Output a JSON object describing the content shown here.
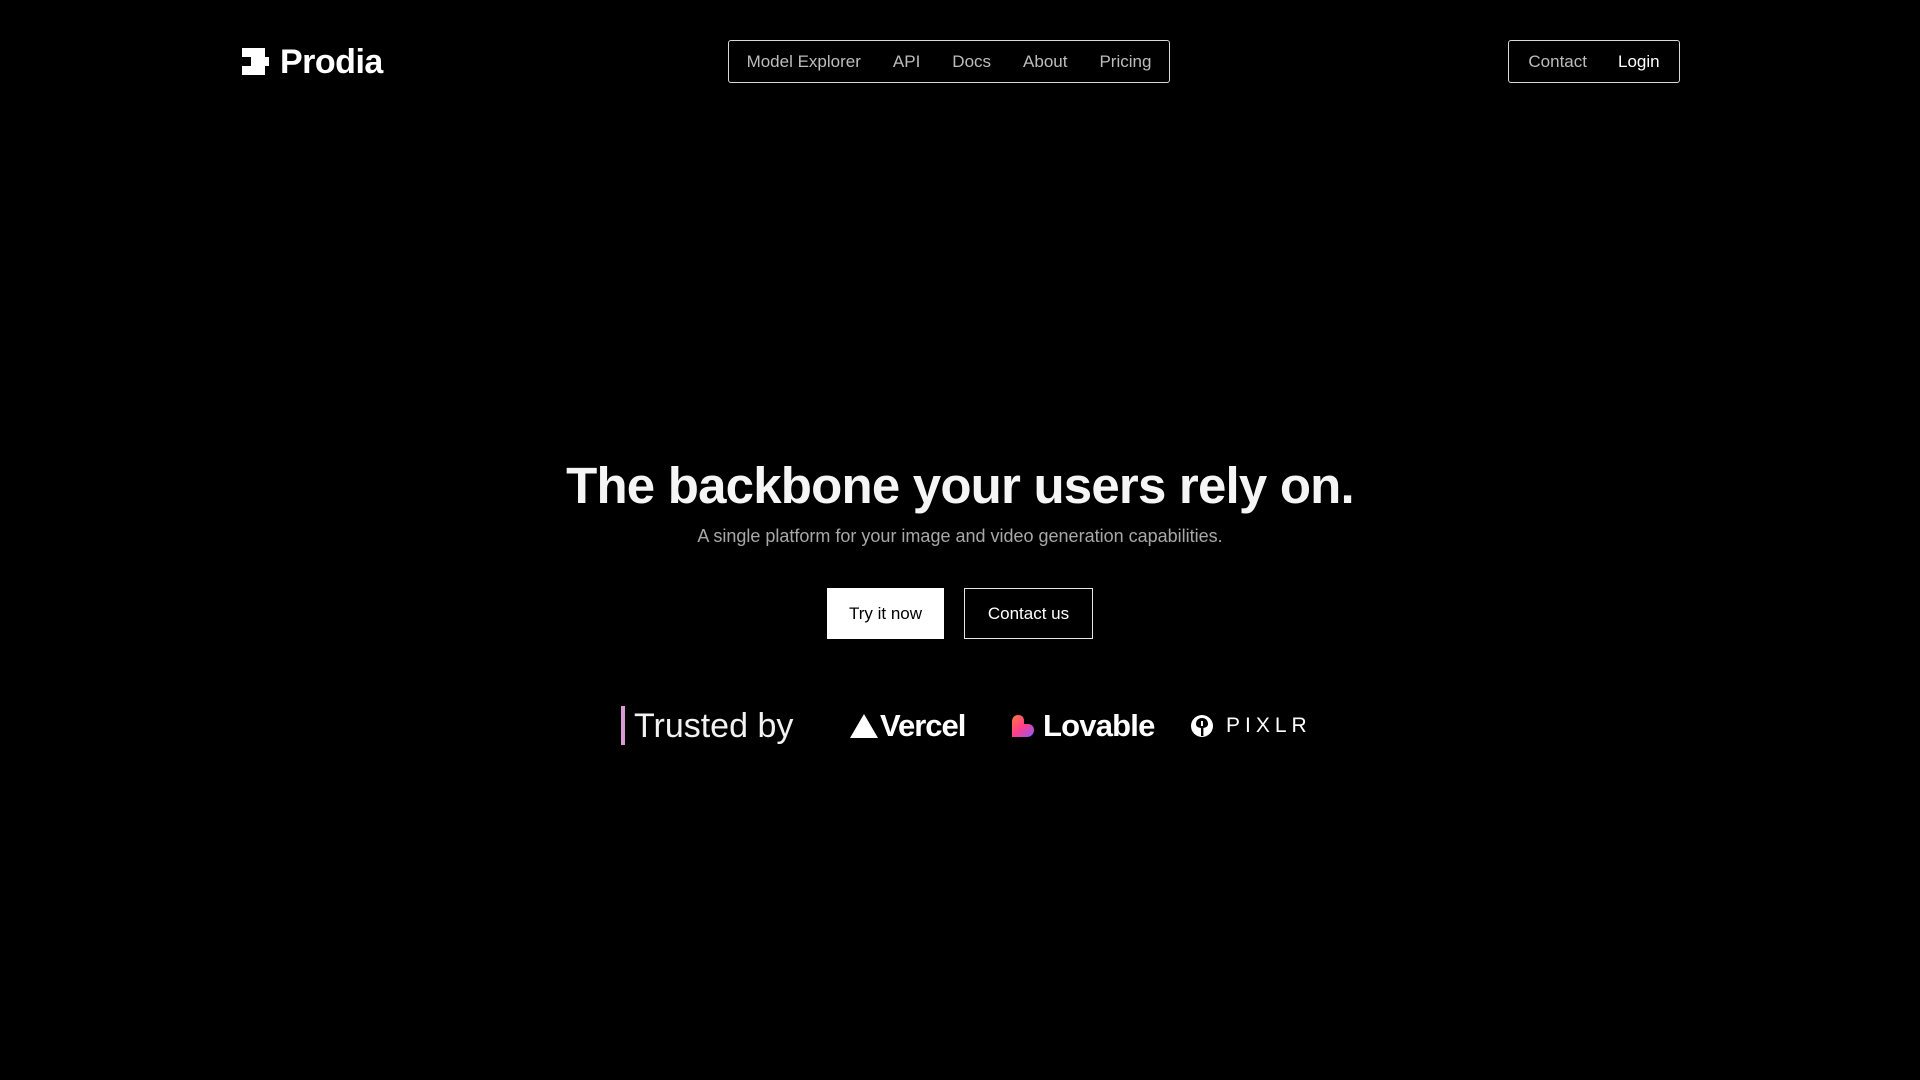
{
  "brand": {
    "name": "Prodia",
    "icon": "prodia-logo-icon"
  },
  "nav": {
    "items": [
      {
        "label": "Model Explorer"
      },
      {
        "label": "API"
      },
      {
        "label": "Docs"
      },
      {
        "label": "About"
      },
      {
        "label": "Pricing"
      }
    ]
  },
  "auth": {
    "contact_label": "Contact",
    "login_label": "Login"
  },
  "hero": {
    "title": "The backbone your users rely on.",
    "subtitle": "A single platform for your image and video generation capabilities.",
    "primary_cta": "Try it now",
    "secondary_cta": "Contact us"
  },
  "trusted": {
    "label": "Trusted by",
    "accent_color": "#d89bd2",
    "logos": [
      {
        "name": "Vercel",
        "icon": "vercel-triangle-icon"
      },
      {
        "name": "Lovable",
        "icon": "lovable-heart-icon"
      },
      {
        "name": "PIXLR",
        "icon": "pixlr-icon"
      }
    ]
  },
  "colors": {
    "background": "#000000",
    "text": "#ffffff",
    "muted": "#bdbdbd"
  }
}
